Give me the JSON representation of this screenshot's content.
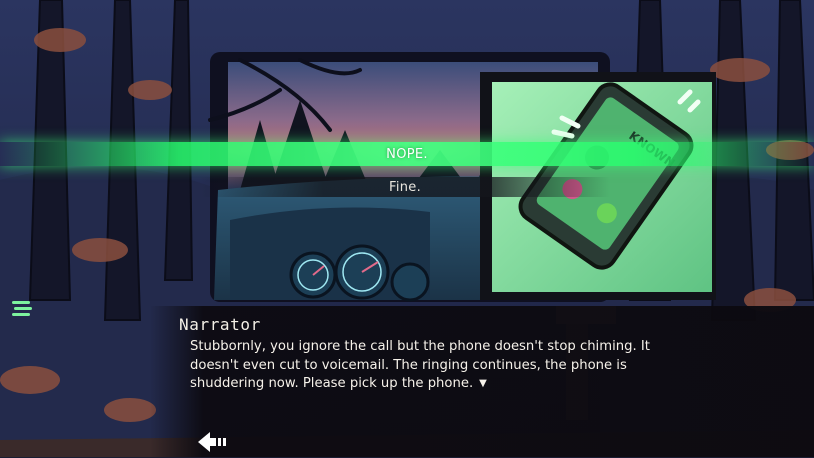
{
  "scene": {
    "description_icon": "phone-ringing-icon",
    "phone_screen_text": "KNOWN"
  },
  "choices": [
    {
      "label": "NOPE.",
      "state": "highlighted"
    },
    {
      "label": "Fine.",
      "state": "normal"
    }
  ],
  "dialogue": {
    "speaker": "Narrator",
    "text": "Stubbornly, you ignore the call but the phone doesn't stop chiming. It doesn't even cut to voicemail. The ringing continues, the phone is shuddering now. Please pick up the phone.",
    "continue_icon": "▼"
  },
  "controls": {
    "back_icon": "back-arrow-icon",
    "menu_icon": "menu-icon"
  },
  "colors": {
    "highlight": "#3bff78",
    "panel_green": "#8fe6a6",
    "night_sky": "#1a1d33"
  }
}
